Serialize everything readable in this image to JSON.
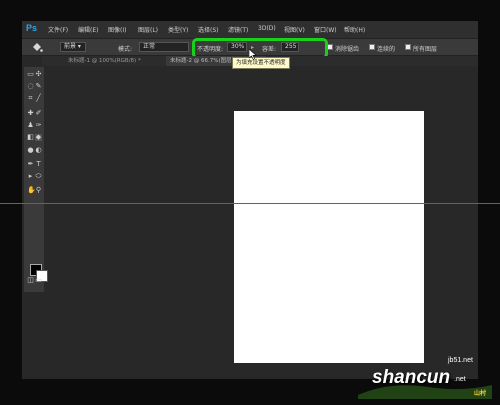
{
  "app": {
    "logo": "Ps"
  },
  "menu": [
    {
      "label": "文件(F)"
    },
    {
      "label": "编辑(E)"
    },
    {
      "label": "图像(I)"
    },
    {
      "label": "图层(L)"
    },
    {
      "label": "类型(Y)"
    },
    {
      "label": "选择(S)"
    },
    {
      "label": "滤镜(T)"
    },
    {
      "label": "3D(D)"
    },
    {
      "label": "视图(V)"
    },
    {
      "label": "窗口(W)"
    },
    {
      "label": "帮助(H)"
    }
  ],
  "options": {
    "preset_icon": "paint-bucket-icon",
    "fill_source": "前景",
    "mode_label": "模式:",
    "mode_value": "正常",
    "opacity_label": "不透明度:",
    "opacity_value": "30%",
    "tolerance_label": "容差:",
    "tolerance_value": "255",
    "antialias_label": "消除锯齿",
    "contiguous_label": "连续的",
    "all_layers_label": "所有图层"
  },
  "tooltip": "为填充设置不透明度",
  "tabs": [
    {
      "label": "未标题-1 @ 100%(RGB/8) *"
    },
    {
      "label": "未标题-2 @ 66.7%(图层 1"
    }
  ],
  "colors": {
    "foreground": "#000000",
    "background": "#ffffff",
    "guide": "#d6303c",
    "highlight": "#19d01b",
    "accent": "#2fa3e6"
  },
  "watermark": {
    "domain": "jb51.net",
    "brand": "shancun",
    "suffix": ".net",
    "tag": "山村"
  }
}
